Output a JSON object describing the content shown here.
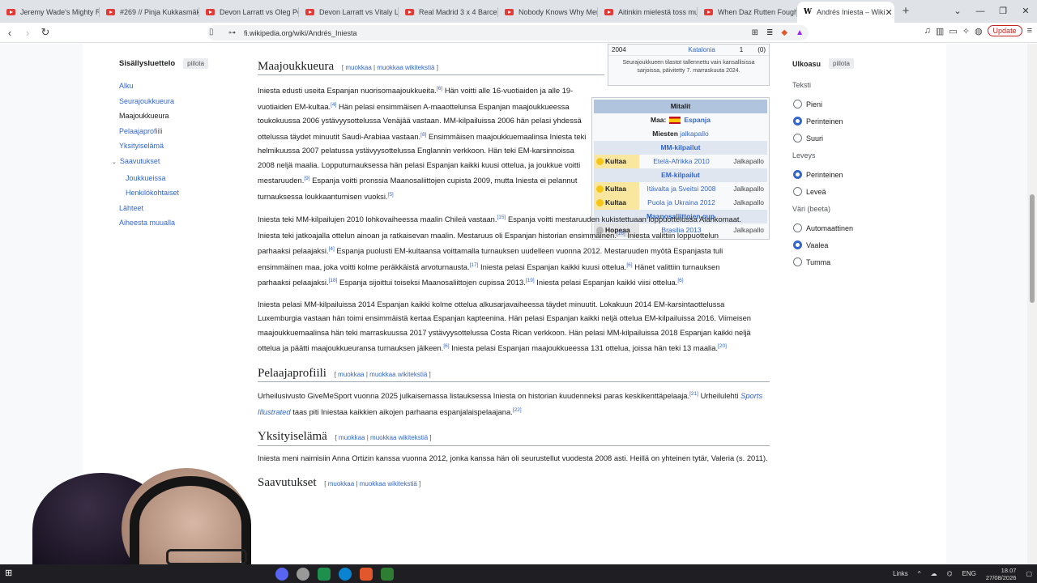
{
  "browser": {
    "tabs": [
      {
        "title": "Jeremy Wade's Mighty Ri"
      },
      {
        "title": "#269 // Pinja Kukkasmäki"
      },
      {
        "title": "Devon Larratt vs Oleg Pet"
      },
      {
        "title": "Devon Larratt vs Vitaly Lal"
      },
      {
        "title": "Real Madrid 3 x 4 Barcelo"
      },
      {
        "title": "Nobody Knows Why Mer"
      },
      {
        "title": "Aitinkin mielestä toss mu"
      },
      {
        "title": "When Daz Rutten Fought"
      },
      {
        "title": "Andrés Iniesta – Wiki",
        "active": true
      }
    ],
    "url": "fi.wikipedia.org/wiki/Andrés_Iniesta",
    "update_label": "Update",
    "new_tab": "+",
    "close_tab": "✕"
  },
  "toc": {
    "title": "Sisällysluettelo",
    "hide": "piilota",
    "items": [
      {
        "label": "Alku"
      },
      {
        "label": "Seurajoukkueura"
      },
      {
        "label": "Maajoukkueura",
        "current": true
      },
      {
        "label": "Pelaajaprofiili"
      },
      {
        "label": "Yksityiselämä"
      },
      {
        "label": "Saavutukset"
      },
      {
        "label": "Joukkueissa"
      },
      {
        "label": "Henkilökohtaiset"
      },
      {
        "label": "Lähteet"
      },
      {
        "label": "Aiheesta muualla"
      }
    ]
  },
  "infobox_top": {
    "year": "2004",
    "place": "Katalonia",
    "apps": "1",
    "goals": "(0)",
    "note": "Seurajoukkueen tilastot tallennettu vain kansallisissa sarjoissa, päivitetty 7. marraskuuta 2024."
  },
  "medals": {
    "title": "Mitalit",
    "country_label": "Maa:",
    "country": "Espanja",
    "sport_label": "Miesten",
    "sport": "jalkapallo",
    "sections": [
      {
        "name": "MM-kilpailut",
        "rows": [
          {
            "medal": "Kultaa",
            "event": "Etelä-Afrikka 2010",
            "sport": "Jalkapallo"
          }
        ]
      },
      {
        "name": "EM-kilpailut",
        "rows": [
          {
            "medal": "Kultaa",
            "event": "Itävalta ja Sveitsi 2008",
            "sport": "Jalkapallo"
          },
          {
            "medal": "Kultaa",
            "event": "Puola ja Ukraina 2012",
            "sport": "Jalkapallo"
          }
        ]
      },
      {
        "name": "Maanosaliittojen cup",
        "rows": [
          {
            "medal": "Hopeaa",
            "event": "Brasilia 2013",
            "sport": "Jalkapallo"
          }
        ]
      }
    ]
  },
  "edit": {
    "edit": "muokkaa",
    "edit_wiki": "muokkaa wikitekstiä"
  },
  "sections": {
    "maajoukkue": {
      "title": "Maajoukkueura",
      "p1": [
        "Iniesta edusti useita Espanjan nuorisomaajoukkueita.",
        "Hän voitti alle 16-vuotiaiden ja alle 19-vuotiaiden EM-kultaa.",
        "Hän pelasi ensimmäisen A-maaottelunsa Espanjan maajoukkueessa toukokuussa 2006 ystävyysottelussa Venäjää vastaan. MM-kilpailuissa 2006 hän pelasi yhdessä ottelussa täydet minuutit Saudi-Arabiaa vastaan.",
        "Ensimmäisen maajoukkuemaalinsa Iniesta teki helmikuussa 2007 pelatussa ystävyysottelussa Englannin verkkoon. Hän teki EM-karsinnoissa 2008 neljä maalia. Lopputurnauksessa hän pelasi Espanjan kaikki kuusi ottelua, ja joukkue voitti mestaruuden.",
        "Espanja voitti pronssia Maanosaliittojen cupista 2009, mutta Iniesta ei pelannut turnauksessa loukkaantumisen vuoksi."
      ],
      "p2": [
        "Iniesta teki MM-kilpailujen 2010 lohkovaiheessa maalin Chileä vastaan.",
        "Espanja voitti mestaruuden kukistettuaan loppuottelussa Alankomaat. Iniesta teki jatkoajalla ottelun ainoan ja ratkaisevan maalin. Mestaruus oli Espanjan historian ensimmäinen.",
        "Iniesta valittiin loppuottelun parhaaksi pelaajaksi.",
        "Espanja puolusti EM-kultaansa voittamalla turnauksen uudelleen vuonna 2012. Mestaruuden myötä Espanjasta tuli ensimmäinen maa, joka voitti kolme peräkkäistä arvoturnausta.",
        "Iniesta pelasi Espanjan kaikki kuusi ottelua.",
        "Hänet valittiin turnauksen parhaaksi pelaajaksi.",
        "Espanja sijoittui toiseksi Maanosaliittojen cupissa 2013.",
        "Iniesta pelasi Espanjan kaikki viisi ottelua."
      ],
      "p3": [
        "Iniesta pelasi MM-kilpailuissa 2014 Espanjan kaikki kolme ottelua alkusarjavaiheessa täydet minuutit. Lokakuun 2014 EM-karsintaottelussa Luxemburgia vastaan hän toimi ensimmäistä kertaa Espanjan kapteenina. Hän pelasi Espanjan kaikki neljä ottelua EM-kilpailuissa 2016. Viimeisen maajoukkuemaalinsa hän teki marraskuussa 2017 ystävyysottelussa Costa Rican verkkoon. Hän pelasi MM-kilpailuissa 2018 Espanjan kaikki neljä ottelua ja päätti maajoukkueuransa turnauksen jälkeen.",
        "Iniesta pelasi Espanjan maajoukkueessa 131 ottelua, joissa hän teki 13 maalia."
      ]
    },
    "profiili": {
      "title": "Pelaajaprofiili",
      "p1a": "Urheilusivusto GiveMeSport vuonna 2025 julkaisemassa listauksessa Iniesta on historian kuudenneksi paras keskikenttäpelaaja.",
      "p1b": "Urheilulehti",
      "p1c": "Sports Illustrated",
      "p1d": "taas piti Iniestaa kaikkien aikojen parhaana espanjalaispelaajana."
    },
    "yksityis": {
      "title": "Yksityiselämä",
      "p1": "Iniesta meni naimisiin Anna Ortizin kanssa vuonna 2012, jonka kanssa hän oli seurustellut vuodesta 2008 asti. Heillä on yhteinen tytär, Valeria (s. 2011)."
    },
    "saavutukset": {
      "title": "Saavutukset"
    }
  },
  "refs": {
    "r6": "[6]",
    "r4": "[4]",
    "r8": "[8]",
    "r9": "[9]",
    "r15": "[15]",
    "r16": "[16]",
    "r17": "[17]",
    "r18": "[18]",
    "r19": "[19]",
    "r20": "[20]",
    "r21": "[21]",
    "r22": "[22]",
    "r5": "[5]"
  },
  "appearance": {
    "title": "Ulkoasu",
    "hide": "piilota",
    "text_label": "Teksti",
    "text_opts": [
      {
        "label": "Pieni"
      },
      {
        "label": "Perinteinen",
        "on": true
      },
      {
        "label": "Suuri"
      }
    ],
    "width_label": "Leveys",
    "width_opts": [
      {
        "label": "Perinteinen",
        "on": true
      },
      {
        "label": "Leveä"
      }
    ],
    "color_label": "Väri (beeta)",
    "color_opts": [
      {
        "label": "Automaattinen"
      },
      {
        "label": "Vaalea",
        "on": true
      },
      {
        "label": "Tumma"
      }
    ]
  },
  "taskbar": {
    "links": "Links",
    "lang": "ENG",
    "time": "18.07",
    "date": "27/08/2026"
  }
}
